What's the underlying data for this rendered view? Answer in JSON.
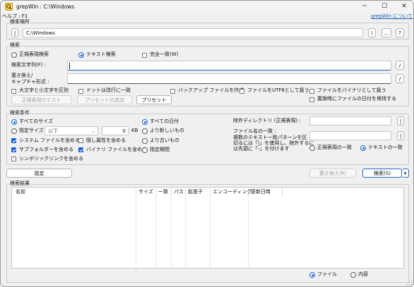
{
  "window": {
    "title": "grepWin : C:\\Windows",
    "help_label": "ヘルプ : F1",
    "about_link": "grepWin について"
  },
  "search_location": {
    "label": "検索場所",
    "path": "C:\\Windows",
    "btn_left": "|",
    "btn_backslash": "\\",
    "btn_browse": "...",
    "btn_question": "?"
  },
  "search": {
    "label": "検索",
    "radio_regex": "正規表現検索",
    "radio_text": "テキスト検索",
    "check_whole_word": "完全一致(W)",
    "search_string_label": "検索文字列(F) :",
    "replace_label_line1": "置き換え/",
    "replace_label_line2": "キャプチャ形式 :",
    "slash": "/",
    "check_case": "大文字と小文字を区別",
    "check_dot_newline": "ドットは改行に一致",
    "check_backup": "バックアップ ファイルを作成",
    "check_utf8": "ファイルをUTF8として扱う",
    "check_binary": "ファイルをバイナリとして扱う",
    "check_keep_date": "置換時にファイルの日付を保持する",
    "btn_test_regex": "正規表現のテスト",
    "btn_add_preset": "プリセットの追加",
    "btn_preset": "プリセット"
  },
  "conditions": {
    "label": "検索条件",
    "radio_all_sizes": "すべてのサイズ",
    "radio_size": "指定サイズ",
    "size_op": "以下",
    "size_value": "0",
    "size_unit": "KB",
    "check_system": "システム ファイルを含める",
    "check_hidden": "隠し属性を含める",
    "check_subfolders": "サブフォルダーを含める",
    "check_binary": "バイナリ ファイルを含める",
    "check_symlinks": "シンボリックリンクを含める",
    "radio_all_dates": "すべての日付",
    "radio_newer": "より新しいもの",
    "radio_older": "より古いもの",
    "radio_range": "指定期間",
    "exclude_dirs_label": "除外ディレクトリ (正規表現) :",
    "file_match_line1": "ファイル名の一致 :",
    "file_match_line2": "複数のテキスト一致パターンを区",
    "file_match_line3": "切るには「|」を使用し、除外するに",
    "file_match_line4": "は先頭に「-」を付けます",
    "radio_regex_match": "正規表現の一致",
    "radio_text_match": "テキストの一致",
    "btn_pipe": "|"
  },
  "actions": {
    "settings": "設定",
    "replace": "置き換え(R)",
    "search": "検索(S)",
    "dropdown": "▾"
  },
  "results": {
    "label": "検索結果",
    "columns": [
      "名前",
      "サイズ",
      "一致",
      "パス",
      "拡張子",
      "エンコーディング",
      "更新日時"
    ],
    "radio_files": "ファイル",
    "radio_content": "内容"
  },
  "colors": {
    "accent": "#1560d4",
    "link": "#1a5fb4"
  }
}
